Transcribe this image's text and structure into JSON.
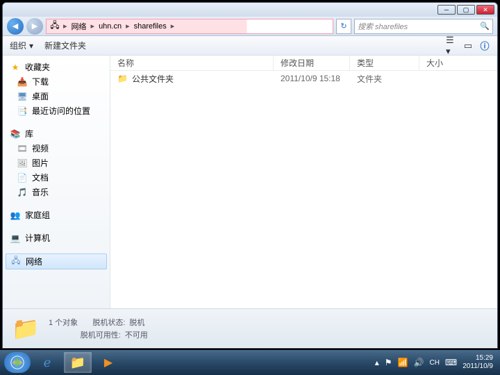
{
  "breadcrumb": {
    "seg1": "网络",
    "seg2": "uhn.cn",
    "seg3": "sharefiles"
  },
  "search": {
    "placeholder": "搜索 sharefiles"
  },
  "toolbar": {
    "organize": "组织",
    "newfolder": "新建文件夹"
  },
  "sidebar": {
    "fav": "收藏夹",
    "dl": "下载",
    "desktop": "桌面",
    "recent": "最近访问的位置",
    "lib": "库",
    "video": "视频",
    "pic": "图片",
    "doc": "文档",
    "music": "音乐",
    "home": "家庭组",
    "comp": "计算机",
    "net": "网络"
  },
  "headers": {
    "name": "名称",
    "date": "修改日期",
    "type": "类型",
    "size": "大小"
  },
  "files": {
    "row0": {
      "name": "公共文件夹",
      "date": "2011/10/9 15:18",
      "type": "文件夹"
    }
  },
  "status": {
    "count": "1 个对象",
    "offlineStateLabel": "脱机状态:",
    "offlineState": "脱机",
    "offlineAvailLabel": "脱机可用性:",
    "offlineAvail": "不可用"
  },
  "tray": {
    "ime": "CH",
    "time": "15:29",
    "date": "2011/10/9"
  }
}
